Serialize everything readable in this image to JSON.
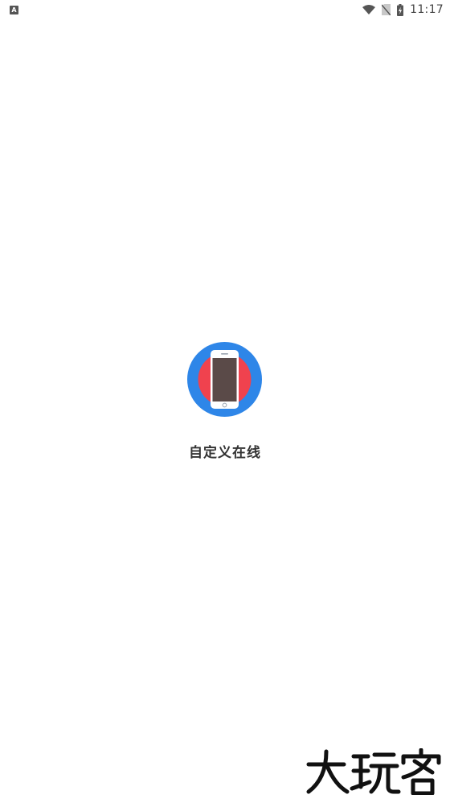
{
  "status_bar": {
    "notification_icon": "A",
    "time": "11:17",
    "icons": [
      "wifi-icon",
      "no-sim-icon",
      "battery-charging-icon"
    ]
  },
  "splash": {
    "logo_icon": "phone-icon",
    "app_name": "自定义在线"
  },
  "watermark": {
    "text": "大玩客"
  },
  "colors": {
    "logo_blue": "#2E86E8",
    "logo_red": "#F0424E",
    "phone_screen": "#5A4A48",
    "background": "#FFFFFF",
    "title_text": "#333333"
  }
}
